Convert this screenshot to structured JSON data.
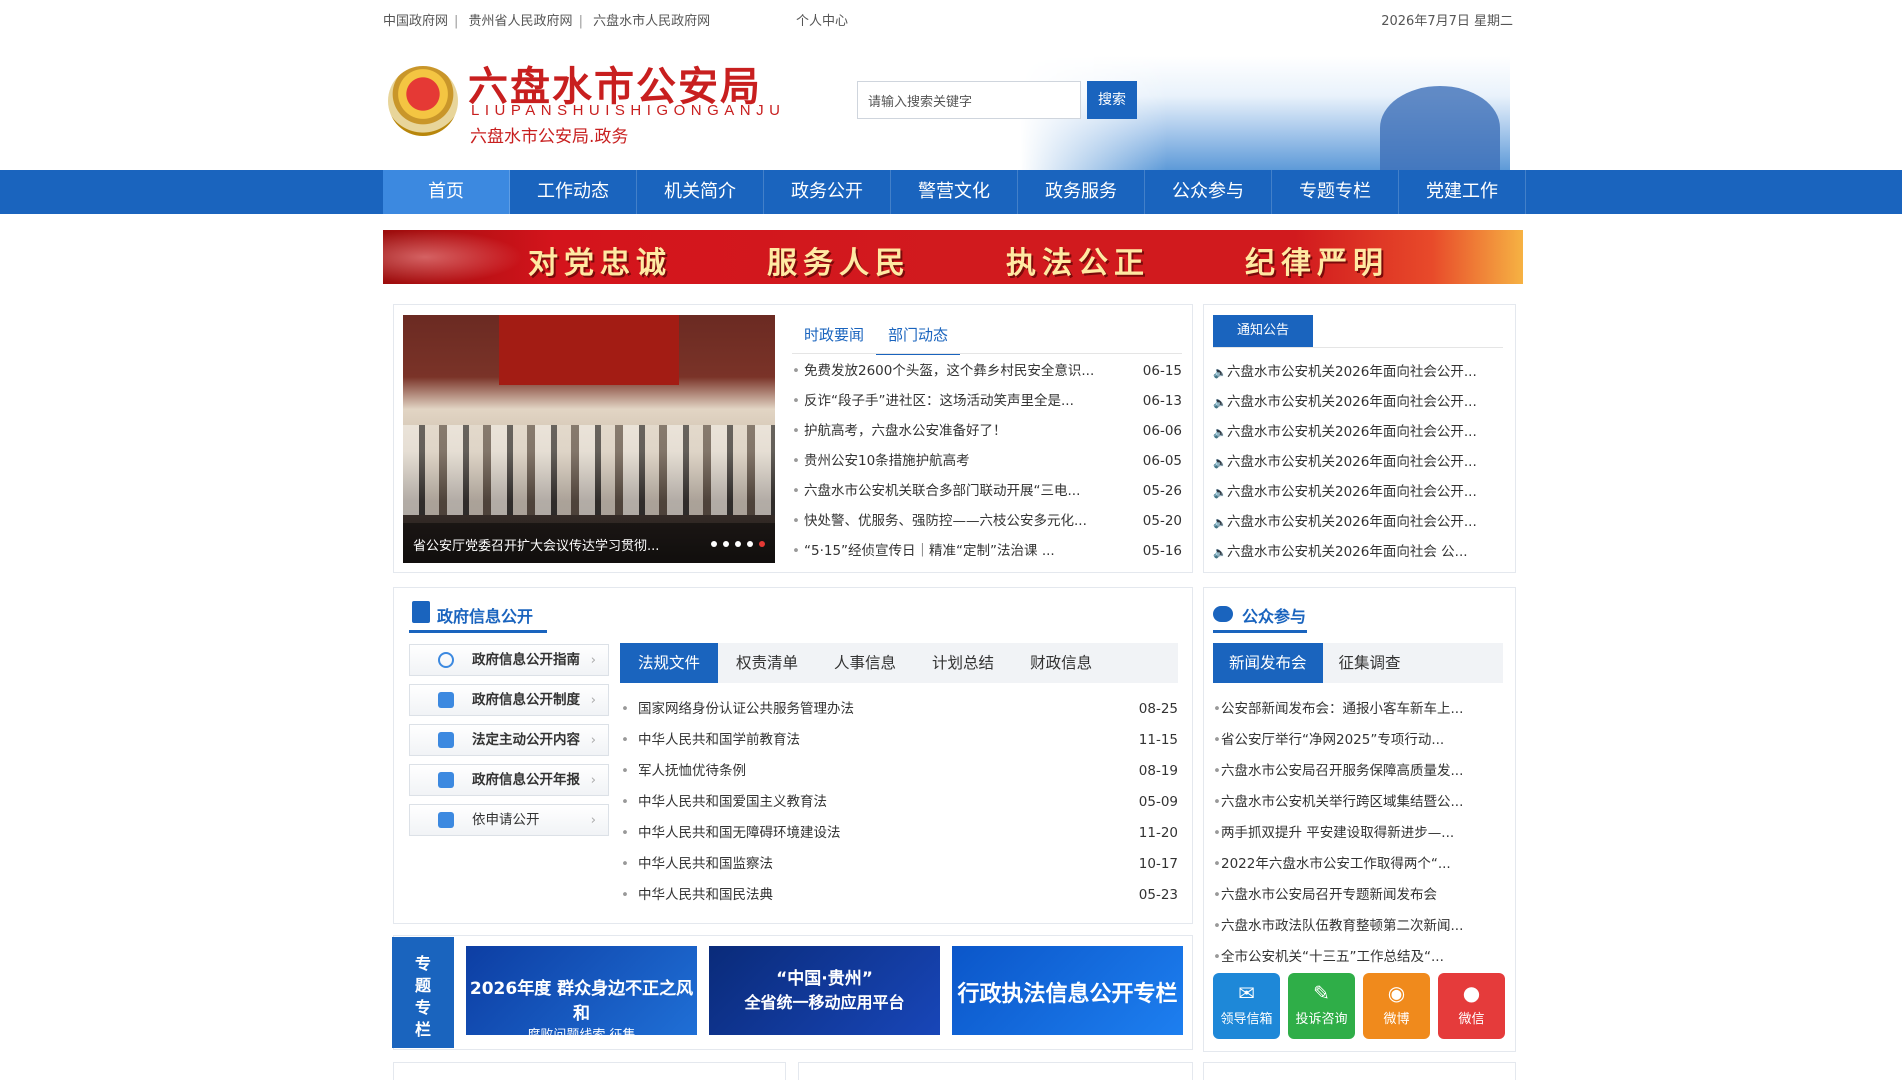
{
  "topbar": {
    "links": [
      "中国政府网",
      "贵州省人民政府网",
      "六盘水市人民政府网"
    ],
    "personal_center": "个人中心",
    "date": "2026年7月7日 星期二"
  },
  "header": {
    "title": "六盘水市公安局",
    "pinyin": "LIUPANSHUISHIGONGANJU",
    "subtitle": "六盘水市公安局.政务",
    "search_placeholder": "请输入搜索关键字",
    "search_button": "搜索"
  },
  "nav": {
    "items": [
      "首页",
      "工作动态",
      "机关简介",
      "政务公开",
      "警营文化",
      "政务服务",
      "公众参与",
      "专题专栏",
      "党建工作"
    ],
    "active_index": 0
  },
  "banner": {
    "slogans": [
      "对党忠诚",
      "服务人民",
      "执法公正",
      "纪律严明"
    ]
  },
  "slideshow": {
    "caption": "省公安厅党委召开扩大会议传达学习贯彻..."
  },
  "news": {
    "tabs": [
      "时政要闻",
      "部门动态"
    ],
    "active_tab": 1,
    "items": [
      {
        "title": "免费发放2600个头盔，这个彝乡村民安全意识...",
        "date": "06-15"
      },
      {
        "title": "反诈“段子手”进社区：这场活动笑声里全是...",
        "date": "06-13"
      },
      {
        "title": "护航高考，六盘水公安准备好了！",
        "date": "06-06"
      },
      {
        "title": "贵州公安10条措施护航高考",
        "date": "06-05"
      },
      {
        "title": "六盘水市公安机关联合多部门联动开展“三电...",
        "date": "05-26"
      },
      {
        "title": "快处警、优服务、强防控——六枝公安多元化...",
        "date": "05-20"
      },
      {
        "title": "“5·15”经侦宣传日｜精准“定制”法治课 ...",
        "date": "05-16"
      }
    ]
  },
  "notices": {
    "tab": "通知公告",
    "items": [
      "六盘水市公安机关2026年面向社会公开...",
      "六盘水市公安机关2026年面向社会公开...",
      "六盘水市公安机关2026年面向社会公开...",
      "六盘水市公安机关2026年面向社会公开...",
      "六盘水市公安机关2026年面向社会公开...",
      "六盘水市公安机关2026年面向社会公开...",
      "六盘水市公安机关2026年面向社会 公..."
    ]
  },
  "gov_info": {
    "title": "政府信息公开",
    "side_buttons": [
      "政府信息公开指南",
      "政府信息公开制度",
      "法定主动公开内容",
      "政府信息公开年报",
      "依申请公开"
    ],
    "tabs": [
      "法规文件",
      "权责清单",
      "人事信息",
      "计划总结",
      "财政信息"
    ],
    "active_tab": 0,
    "items": [
      {
        "title": "国家网络身份认证公共服务管理办法",
        "date": "08-25"
      },
      {
        "title": "中华人民共和国学前教育法",
        "date": "11-15"
      },
      {
        "title": "军人抚恤优待条例",
        "date": "08-19"
      },
      {
        "title": "中华人民共和国爱国主义教育法",
        "date": "05-09"
      },
      {
        "title": "中华人民共和国无障碍环境建设法",
        "date": "11-20"
      },
      {
        "title": "中华人民共和国监察法",
        "date": "10-17"
      },
      {
        "title": "中华人民共和国民法典",
        "date": "05-23"
      }
    ]
  },
  "topics": {
    "label": "专题专栏",
    "banners": [
      {
        "line1": "2026年度 群众身边不正之风和",
        "line2": "腐败问题线索 征集"
      },
      {
        "line1": "“中国·贵州”",
        "line2": "全省统一移动应用平台"
      },
      {
        "line1": "行政执法信息公开专栏",
        "line2": ""
      }
    ]
  },
  "public": {
    "title": "公众参与",
    "tabs": [
      "新闻发布会",
      "征集调查"
    ],
    "active_tab": 0,
    "items": [
      "公安部新闻发布会：通报小客车新车上...",
      "省公安厅举行“净网2025”专项行动...",
      "六盘水市公安局召开服务保障高质量发...",
      "六盘水市公安机关举行跨区域集结暨公...",
      "两手抓双提升 平安建设取得新进步—...",
      "2022年六盘水市公安工作取得两个“...",
      "六盘水市公安局召开专题新闻发布会",
      "六盘水市政法队伍教育整顿第二次新闻...",
      "全市公安机关“十三五”工作总结及“..."
    ],
    "quick_links": [
      {
        "label": "领导信箱",
        "icon": "mail-icon",
        "color": "#1e88d8"
      },
      {
        "label": "投诉咨询",
        "icon": "edit-icon",
        "color": "#2fae48"
      },
      {
        "label": "微博",
        "icon": "weibo-icon",
        "color": "#f08a1c"
      },
      {
        "label": "微信",
        "icon": "wechat-icon",
        "color": "#e53b3b"
      }
    ]
  },
  "colors": {
    "primary": "#1a64be",
    "brand_red": "#c81f1f",
    "nav_active": "#3c89e0"
  }
}
